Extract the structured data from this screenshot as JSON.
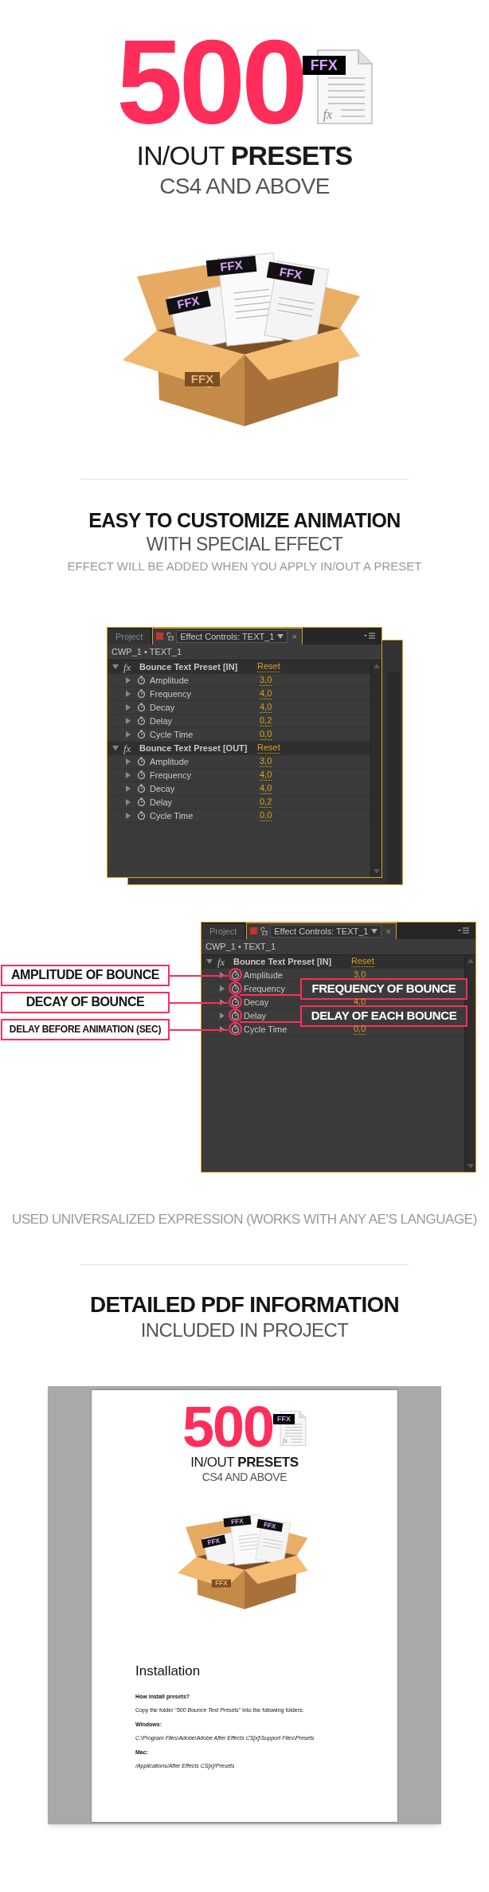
{
  "hero": {
    "number": "500",
    "badge": "FFX",
    "file_mark": "fx",
    "line_light": "IN/OUT",
    "line_bold": "PRESETS",
    "subline": "CS4 AND ABOVE"
  },
  "box": {
    "labels": [
      "FFX",
      "FFX",
      "FFX"
    ],
    "side_label": "FFX"
  },
  "customize": {
    "title": "EASY TO CUSTOMIZE ANIMATION",
    "subtitle": "WITH SPECIAL EFFECT",
    "note": "EFFECT WILL BE ADDED WHEN YOU APPLY IN/OUT A PRESET",
    "panel": {
      "tabs": [
        {
          "label": "Project",
          "selected": false
        },
        {
          "label": "Effect Controls: TEXT_1",
          "selected": true
        }
      ],
      "close": "×",
      "breadcrumb": "CWP_1 • TEXT_1",
      "effects": [
        {
          "fx": "fx",
          "name": "Bounce Text Preset [IN]",
          "reset": "Reset",
          "expanded": true,
          "params": [
            {
              "name": "Amplitude",
              "value": "3,0"
            },
            {
              "name": "Frequency",
              "value": "4,0"
            },
            {
              "name": "Decay",
              "value": "4,0"
            },
            {
              "name": "Delay",
              "value": "0,2"
            },
            {
              "name": "Cycle Time",
              "value": "0,0"
            }
          ]
        },
        {
          "fx": "fx",
          "name": "Bounce Text Preset [OUT]",
          "reset": "Reset",
          "expanded": true,
          "params": [
            {
              "name": "Amplitude",
              "value": "3,0"
            },
            {
              "name": "Frequency",
              "value": "4,0"
            },
            {
              "name": "Decay",
              "value": "4,0"
            },
            {
              "name": "Delay",
              "value": "0,2"
            },
            {
              "name": "Cycle Time",
              "value": "0,0"
            }
          ]
        }
      ]
    }
  },
  "annotated": {
    "panel": {
      "tabs": [
        {
          "label": "Project",
          "selected": false
        },
        {
          "label": "Effect Controls: TEXT_1",
          "selected": true
        }
      ],
      "close": "×",
      "breadcrumb": "CWP_1 • TEXT_1",
      "effects": [
        {
          "fx": "fx",
          "name": "Bounce Text Preset [IN]",
          "reset": "Reset",
          "expanded": true,
          "params": [
            {
              "name": "Amplitude",
              "value": "3,0",
              "circled": true,
              "callout_left": "AMPLITUDE OF BOUNCE"
            },
            {
              "name": "Frequency",
              "circled": true,
              "callout_right": "FREQUENCY OF BOUNCE"
            },
            {
              "name": "Decay",
              "value": "4,0",
              "circled": true,
              "callout_left": "DECAY OF BOUNCE"
            },
            {
              "name": "Delay",
              "circled": true,
              "callout_right": "DELAY OF EACH BOUNCE"
            },
            {
              "name": "Cycle Time",
              "value": "0,0",
              "circled": true,
              "callout_left": "DELAY BEFORE ANIMATION (SEC)"
            }
          ]
        }
      ]
    },
    "footnote": "USED UNIVERSALIZED EXPRESSION (WORKS WITH ANY AE'S LANGUAGE)"
  },
  "pdf": {
    "title": "DETAILED PDF INFORMATION",
    "subtitle": "INCLUDED IN PROJECT",
    "page": {
      "hero": {
        "number": "500",
        "badge": "FFX",
        "file_mark": "fx",
        "line_light": "IN/OUT",
        "line_bold": "PRESETS",
        "subline": "CS4 AND ABOVE"
      },
      "box": {
        "labels": [
          "FFX",
          "FFX",
          "FFX"
        ],
        "side_label": "FFX"
      },
      "heading": "Installation",
      "lines": [
        {
          "kind": "bold",
          "text": "How install presets?"
        },
        {
          "kind": "plain",
          "text": "Copy the folder \"*500 Bounce Text Presets*\" into the following folders:"
        },
        {
          "kind": "bold",
          "text": "Windows:"
        },
        {
          "kind": "path",
          "text": "C:\\Program Files\\Adobe\\Adobe After Effects CS[x]\\Support Files\\Presets"
        },
        {
          "kind": "bold",
          "text": "Mac:"
        },
        {
          "kind": "path",
          "text": "/Applications/After Effects CS[x]/Presets"
        }
      ]
    }
  }
}
